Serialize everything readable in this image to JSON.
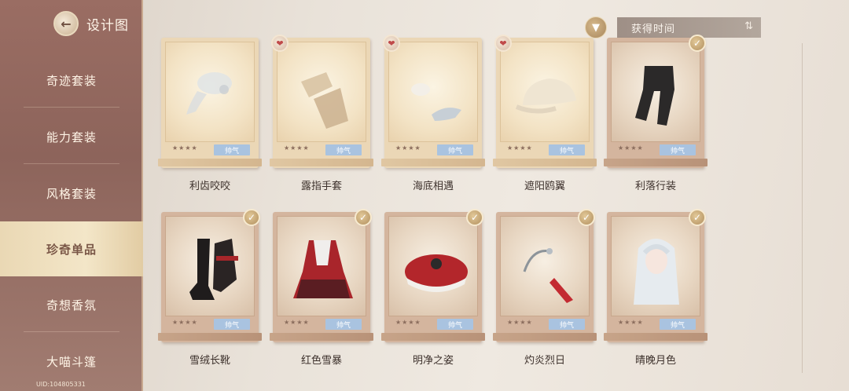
{
  "header": {
    "title": "设计图",
    "back_icon": "back-arrow-icon"
  },
  "sidebar": {
    "items": [
      {
        "label": "奇迹套装",
        "active": false
      },
      {
        "label": "能力套装",
        "active": false
      },
      {
        "label": "风格套装",
        "active": false
      },
      {
        "label": "珍奇单品",
        "active": true
      },
      {
        "label": "奇想香氛",
        "active": false
      },
      {
        "label": "大喵斗篷",
        "active": false
      }
    ],
    "uid": "UID:104805331"
  },
  "toolbar": {
    "filter_icon": "funnel-filter-icon",
    "sort_label": "获得时间",
    "sort_icon": "sort-toggle-icon"
  },
  "colors": {
    "sidebar_bg": "#8d645b",
    "active_tab": "#f3e6c8",
    "style_tag": "#a9c3e0",
    "check_badge": "#b18f5e"
  },
  "cards": [
    {
      "name": "利齿咬咬",
      "stars": "★★★★",
      "tag": "帅气",
      "owned": false,
      "badge": "none",
      "icon": "scarf-item-icon"
    },
    {
      "name": "露指手套",
      "stars": "★★★★",
      "tag": "帅气",
      "owned": false,
      "badge": "heart",
      "icon": "gloves-item-icon"
    },
    {
      "name": "海底相遇",
      "stars": "★★★★",
      "tag": "帅气",
      "owned": false,
      "badge": "heart",
      "icon": "shark-accessory-icon"
    },
    {
      "name": "遮阳鸥翼",
      "stars": "★★★★",
      "tag": "帅气",
      "owned": false,
      "badge": "heart",
      "icon": "cap-item-icon"
    },
    {
      "name": "利落行装",
      "stars": "★★★★",
      "tag": "帅气",
      "owned": true,
      "badge": "check",
      "icon": "pants-item-icon"
    },
    {
      "name": "雪绒长靴",
      "stars": "★★★★",
      "tag": "帅气",
      "owned": true,
      "badge": "check",
      "icon": "boots-item-icon"
    },
    {
      "name": "红色雪暴",
      "stars": "★★★★",
      "tag": "帅气",
      "owned": true,
      "badge": "check",
      "icon": "red-dress-item-icon"
    },
    {
      "name": "明净之姿",
      "stars": "★★★★",
      "tag": "帅气",
      "owned": true,
      "badge": "check",
      "icon": "red-beret-item-icon"
    },
    {
      "name": "灼炎烈日",
      "stars": "★★★★",
      "tag": "帅气",
      "owned": true,
      "badge": "check",
      "icon": "red-crystal-earring-icon"
    },
    {
      "name": "晴晚月色",
      "stars": "★★★★",
      "tag": "帅气",
      "owned": true,
      "badge": "check",
      "icon": "silver-hair-item-icon"
    }
  ]
}
